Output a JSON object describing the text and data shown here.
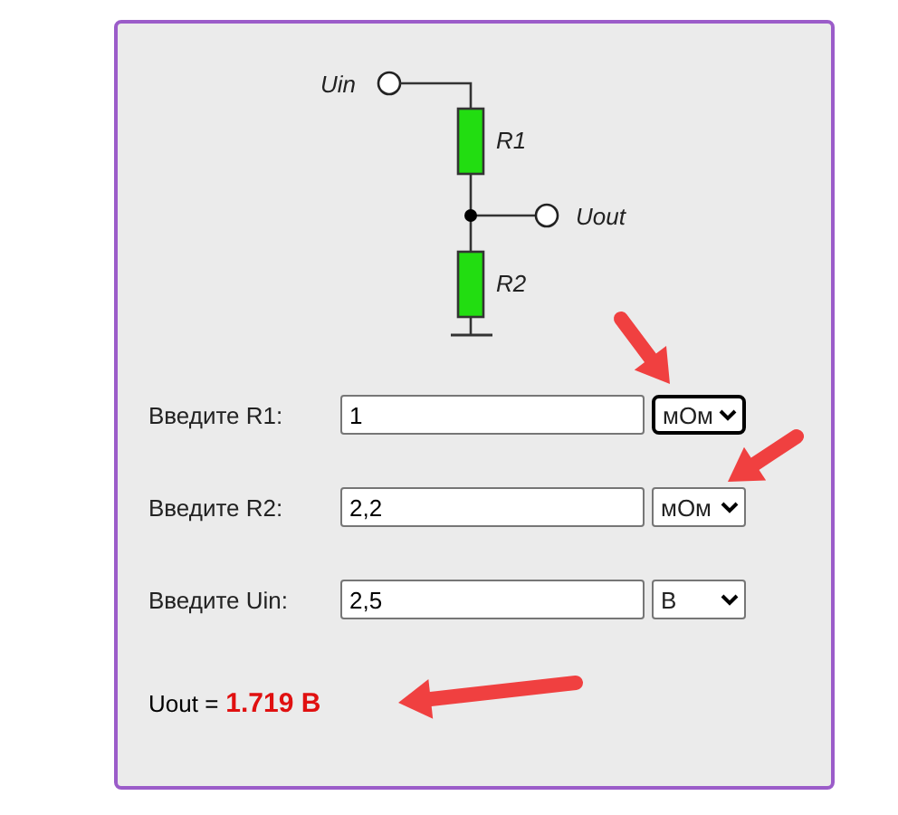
{
  "schematic": {
    "input_label": "Uin",
    "r1_label": "R1",
    "output_label": "Uout",
    "r2_label": "R2"
  },
  "fields": [
    {
      "label": "Введите R1:",
      "value": "1",
      "unit": "мОм",
      "focused": true
    },
    {
      "label": "Введите R2:",
      "value": "2,2",
      "unit": "мОм",
      "focused": false
    },
    {
      "label": "Введите Uin:",
      "value": "2,5",
      "unit": "В",
      "focused": false
    }
  ],
  "result": {
    "label": "Uout =",
    "value": "1.719 В"
  }
}
